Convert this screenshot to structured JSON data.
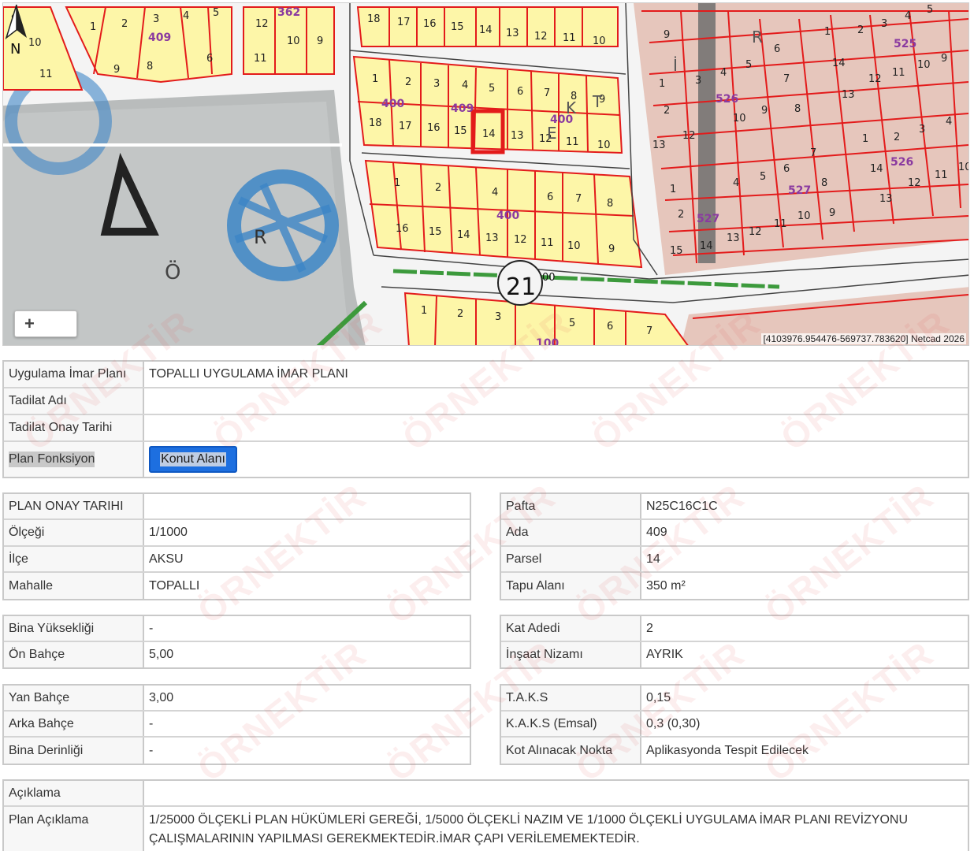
{
  "map": {
    "zoom_label": "+",
    "coords_text": "[4103976.954476-569737.783620] Netcad 2026",
    "north_label": "N",
    "road_label": "21",
    "road_sup": "00",
    "parcel_numbers": [
      "1",
      "2",
      "3",
      "4",
      "5",
      "6",
      "7",
      "8",
      "9",
      "10",
      "11",
      "12",
      "13",
      "14",
      "15",
      "16",
      "17",
      "18"
    ],
    "block_labels": [
      "400",
      "409",
      "362",
      "525",
      "526",
      "527",
      "100"
    ],
    "letters": [
      "R",
      "E",
      "K",
      "T",
      "İ",
      "R",
      "Ö",
      "R"
    ]
  },
  "top_table": {
    "rows": [
      {
        "label": "Uygulama İmar Planı",
        "value": "TOPALLI UYGULAMA İMAR PLANI"
      },
      {
        "label": "Tadilat Adı",
        "value": ""
      },
      {
        "label": "Tadilat Onay Tarihi",
        "value": ""
      },
      {
        "label": "Plan Fonksiyon",
        "value": "Konut Alanı"
      }
    ]
  },
  "left_1": [
    {
      "label": "PLAN ONAY TARIHI",
      "value": ""
    },
    {
      "label": "Ölçeği",
      "value": "1/1000"
    },
    {
      "label": "İlçe",
      "value": "AKSU"
    },
    {
      "label": "Mahalle",
      "value": "TOPALLI"
    }
  ],
  "right_1": [
    {
      "label": "Pafta",
      "value": "N25C16C1C"
    },
    {
      "label": "Ada",
      "value": "409"
    },
    {
      "label": "Parsel",
      "value": "14"
    },
    {
      "label": "Tapu Alanı",
      "value": "350 m²"
    }
  ],
  "left_2": [
    {
      "label": "Bina Yüksekliği",
      "value": "-"
    },
    {
      "label": "Ön Bahçe",
      "value": "5,00"
    }
  ],
  "right_2": [
    {
      "label": "Kat Adedi",
      "value": "2"
    },
    {
      "label": "İnşaat Nizamı",
      "value": "AYRIK"
    }
  ],
  "left_3": [
    {
      "label": "Yan Bahçe",
      "value": "3,00"
    },
    {
      "label": "Arka Bahçe",
      "value": "-"
    },
    {
      "label": "Bina Derinliği",
      "value": "-"
    }
  ],
  "right_3": [
    {
      "label": "T.A.K.S",
      "value": "0,15"
    },
    {
      "label": "K.A.K.S (Emsal)",
      "value": "0,3 (0,30)"
    },
    {
      "label": "Kot Alınacak Nokta",
      "value": "Aplikasyonda Tespit Edilecek"
    }
  ],
  "bottom_table": [
    {
      "label": "Açıklama",
      "value": ""
    },
    {
      "label": "Plan Açıklama",
      "value": "1/25000 ÖLÇEKLİ PLAN HÜKÜMLERİ GEREĞİ, 1/5000 ÖLÇEKLİ NAZIM VE 1/1000 ÖLÇEKLİ UYGULAMA İMAR PLANI REVİZYONU ÇALIŞMALARININ YAPILMASI GEREKMEKTEDİR.İMAR ÇAPI VERİLEMEMEKTEDİR."
    }
  ],
  "watermark": "ÖRNEKTİR",
  "colors": {
    "parcel_fill": "#fdf6a8",
    "parcel_line": "#e31b1b",
    "selected_parcel": "#e31b1b",
    "button_blue": "#1d6fe0",
    "park_blue": "#3d86c6",
    "pink_area": "#e9c9c0"
  }
}
